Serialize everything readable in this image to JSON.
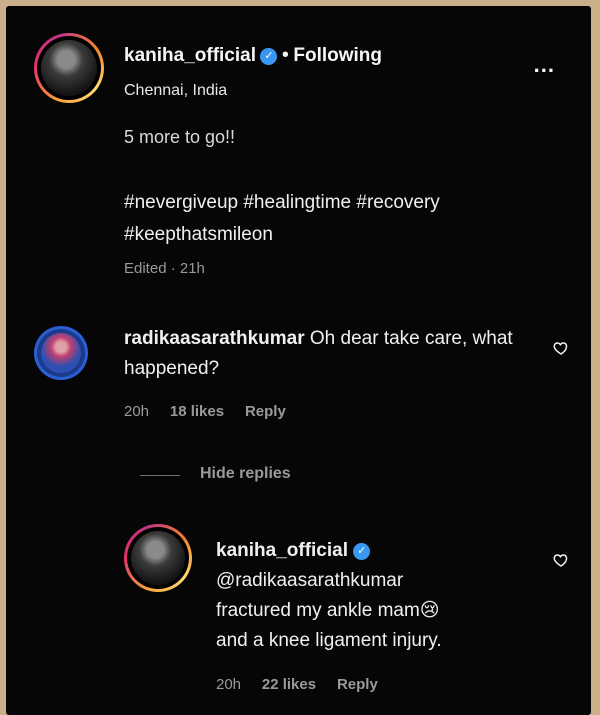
{
  "post": {
    "author": "kaniha_official",
    "separator": "•",
    "follow_status": "Following",
    "location": "Chennai, India",
    "more_label": "...",
    "caption_clipped": "5 more to go!!",
    "caption_hashtags": "#nevergiveup #healingtime #recovery #keepthatsmileon",
    "edited_meta": "Edited · 21h"
  },
  "comments": [
    {
      "username": "radikaasarathkumar",
      "text": "Oh dear take care, what happened?",
      "time": "20h",
      "likes": "18 likes",
      "reply_label": "Reply"
    }
  ],
  "replies_toggle": "Hide replies",
  "replies": [
    {
      "username": "kaniha_official",
      "line1": "@radikaasarathkumar",
      "line2": "fractured my ankle mam",
      "emoji": "😢",
      "line3": "and a knee ligament injury.",
      "time": "20h",
      "likes": "22 likes",
      "reply_label": "Reply"
    }
  ],
  "icons": {
    "verified": "verified-badge-icon",
    "heart": "heart-outline-icon",
    "more": "more-options-icon"
  },
  "colors": {
    "background": "#060606",
    "verified": "#3897f0",
    "meta_text": "#9a9a9a"
  }
}
